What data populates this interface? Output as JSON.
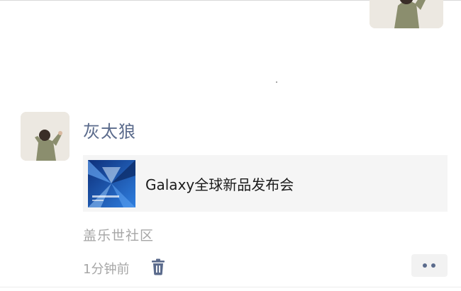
{
  "post": {
    "username": "灰太狼",
    "link": {
      "title": "Galaxy全球新品发布会",
      "thumbnail_icon": "galaxy-event-thumbnail"
    },
    "source": "盖乐世社区",
    "timestamp": "1分钟前",
    "delete_icon": "trash-icon",
    "more_icon": "more-dots-icon"
  },
  "colors": {
    "username": "#5b6b8c",
    "meta_text": "#a6a6a6",
    "card_bg": "#f5f5f5",
    "more_dots": "#5b6b8c"
  }
}
